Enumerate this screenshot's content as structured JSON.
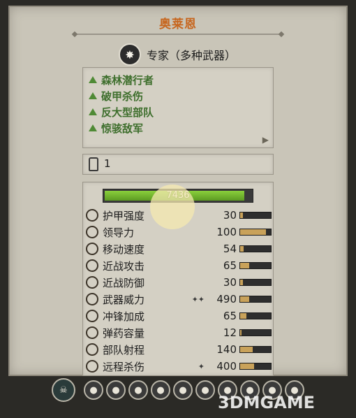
{
  "unit_name": "奥莱恩",
  "unit_class": {
    "icon": "star-burst-icon",
    "label": "专家（多种武器）"
  },
  "abilities": [
    "森林潜行者",
    "破甲杀伤",
    "反大型部队",
    "惊骇敌军"
  ],
  "more_glyph": "▶",
  "rank": {
    "icon": "rank-icon",
    "value": "1"
  },
  "health": {
    "value": "7436",
    "fraction": 0.95
  },
  "stats": [
    {
      "icon": "armor-icon",
      "label": "护甲强度",
      "extra": "",
      "value": "30",
      "fraction": 0.08
    },
    {
      "icon": "leadership-icon",
      "label": "领导力",
      "extra": "",
      "value": "100",
      "fraction": 0.85
    },
    {
      "icon": "speed-icon",
      "label": "移动速度",
      "extra": "",
      "value": "54",
      "fraction": 0.12
    },
    {
      "icon": "melee-attack-icon",
      "label": "近战攻击",
      "extra": "",
      "value": "65",
      "fraction": 0.3
    },
    {
      "icon": "melee-defence-icon",
      "label": "近战防御",
      "extra": "",
      "value": "30",
      "fraction": 0.08
    },
    {
      "icon": "weapon-strength-icon",
      "label": "武器威力",
      "extra": "✦✦",
      "value": "490",
      "fraction": 0.3
    },
    {
      "icon": "charge-bonus-icon",
      "label": "冲锋加成",
      "extra": "",
      "value": "65",
      "fraction": 0.2
    },
    {
      "icon": "ammunition-icon",
      "label": "弹药容量",
      "extra": "",
      "value": "12",
      "fraction": 0.05
    },
    {
      "icon": "range-icon",
      "label": "部队射程",
      "extra": "",
      "value": "140",
      "fraction": 0.4
    },
    {
      "icon": "missile-damage-icon",
      "label": "远程杀伤",
      "extra": "✦",
      "value": "400",
      "fraction": 0.45
    }
  ],
  "bottom_icons": [
    "faction-skull-icon",
    "attr-icon-1",
    "attr-icon-2",
    "attr-icon-3",
    "attr-icon-4",
    "attr-icon-5",
    "attr-icon-6",
    "attr-icon-7",
    "attr-icon-8",
    "attr-icon-9",
    "attr-icon-10"
  ],
  "watermark": "3DMGAME",
  "colors": {
    "title": "#c7661e",
    "ability": "#3d6e2c",
    "health": "#6aaa2a",
    "stat_bar": "#c9a25a"
  }
}
